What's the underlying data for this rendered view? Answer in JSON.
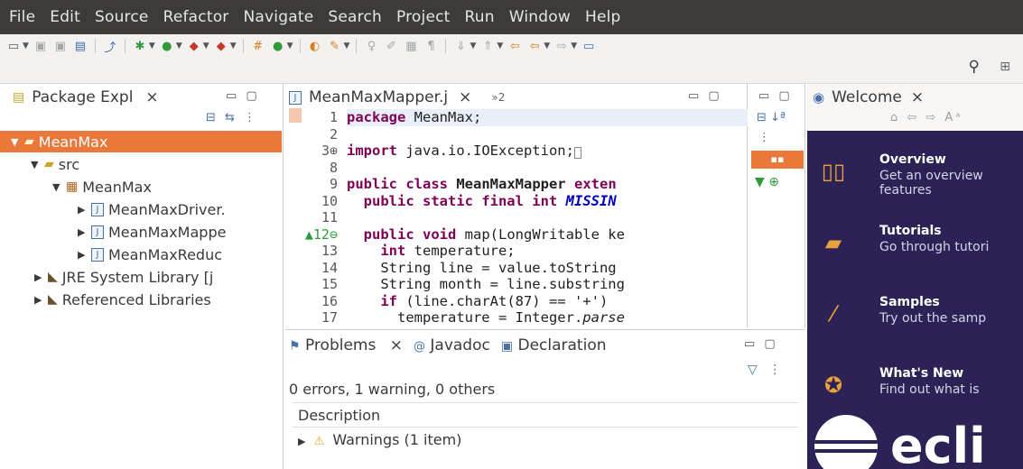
{
  "menu": [
    "File",
    "Edit",
    "Source",
    "Refactor",
    "Navigate",
    "Search",
    "Project",
    "Run",
    "Window",
    "Help"
  ],
  "package_explorer": {
    "tab_label": "Package Expl",
    "close": "×",
    "tree": [
      {
        "label": "MeanMax",
        "indent": 0,
        "twisty": "▼",
        "icon": "project-folder-icon",
        "selected": true
      },
      {
        "label": "src",
        "indent": 1,
        "twisty": "▼",
        "icon": "source-folder-icon"
      },
      {
        "label": "MeanMax",
        "indent": 2,
        "twisty": "▼",
        "icon": "package-icon"
      },
      {
        "label": "MeanMaxDriver.",
        "indent": 3,
        "twisty": "▶",
        "icon": "java-file-icon"
      },
      {
        "label": "MeanMaxMappe",
        "indent": 3,
        "twisty": "▶",
        "icon": "java-file-icon"
      },
      {
        "label": "MeanMaxReduc",
        "indent": 3,
        "twisty": "▶",
        "icon": "java-file-icon"
      },
      {
        "label": "JRE System Library [j",
        "indent": 1,
        "twisty": "▶",
        "icon": "library-icon"
      },
      {
        "label": "Referenced Libraries",
        "indent": 1,
        "twisty": "▶",
        "icon": "library-icon"
      }
    ]
  },
  "editor": {
    "tab_label": "MeanMaxMapper.j",
    "close": "×",
    "more_tabs": "»2",
    "lines": [
      {
        "n": "1",
        "text": "package MeanMax;"
      },
      {
        "n": "2",
        "text": ""
      },
      {
        "n": "3⊕",
        "text": "import java.io.IOException;"
      },
      {
        "n": "8",
        "text": ""
      },
      {
        "n": "9",
        "text": "public class MeanMaxMapper exten"
      },
      {
        "n": "10",
        "text": "  public static final int MISSIN"
      },
      {
        "n": "11",
        "text": ""
      },
      {
        "n": "▲12⊖",
        "text": "  public void map(LongWritable ke"
      },
      {
        "n": "13",
        "text": "    int temperature;"
      },
      {
        "n": "14",
        "text": "    String line = value.toString"
      },
      {
        "n": "15",
        "text": "    String month = line.substring"
      },
      {
        "n": "16",
        "text": "    if (line.charAt(87) == '+') "
      },
      {
        "n": "17",
        "text": "      temperature = Integer.parse"
      }
    ]
  },
  "problems": {
    "tabs": [
      "Problems",
      "Javadoc",
      "Declaration"
    ],
    "close": "×",
    "summary": "0 errors, 1 warning, 0 others",
    "column": "Description",
    "warning_row": "Warnings (1 item)"
  },
  "welcome": {
    "tab_label": "Welcome",
    "close": "×",
    "items": [
      {
        "title": "Overview",
        "sub": "Get an overview",
        "sub2": "features",
        "icon": "book-icon"
      },
      {
        "title": "Tutorials",
        "sub": "Go through tutori",
        "icon": "mortarboard-icon"
      },
      {
        "title": "Samples",
        "sub": "Try out the samp",
        "icon": "magic-wand-icon"
      },
      {
        "title": "What's New",
        "sub": "Find out what is",
        "icon": "star-icon"
      }
    ],
    "logo_text": "ecli"
  }
}
